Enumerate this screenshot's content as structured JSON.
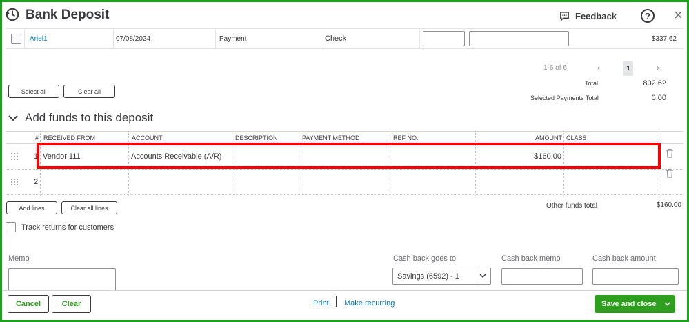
{
  "header": {
    "title": "Bank Deposit",
    "feedback_label": "Feedback",
    "help_label": "?",
    "close_label": "×"
  },
  "payment_row": {
    "name": "Ariel1",
    "date": "07/08/2024",
    "type": "Payment",
    "method": "Check",
    "amount": "$337.62"
  },
  "pager": {
    "range": "1-6 of 6",
    "prev": "‹",
    "page": "1",
    "next": "›"
  },
  "selection": {
    "select_all": "Select all",
    "clear_all": "Clear all"
  },
  "totals": {
    "total_label": "Total",
    "total_value": "802.62",
    "selected_label": "Selected Payments Total",
    "selected_value": "0.00"
  },
  "funds": {
    "section_title": "Add funds to this deposit",
    "columns": [
      "#",
      "RECEIVED FROM",
      "ACCOUNT",
      "DESCRIPTION",
      "PAYMENT METHOD",
      "REF NO.",
      "AMOUNT",
      "CLASS"
    ],
    "rows": [
      {
        "num": "1",
        "received_from": "Vendor 111",
        "account": "Accounts Receivable (A/R)",
        "description": "",
        "payment_method": "",
        "ref_no": "",
        "amount": "$160.00",
        "class": ""
      },
      {
        "num": "2",
        "received_from": "",
        "account": "",
        "description": "",
        "payment_method": "",
        "ref_no": "",
        "amount": "",
        "class": ""
      }
    ],
    "add_lines": "Add lines",
    "clear_all_lines": "Clear all lines",
    "other_total_label": "Other funds total",
    "other_total_value": "$160.00",
    "track_returns": "Track returns for customers"
  },
  "form": {
    "memo_label": "Memo",
    "cash_back_goes_to_label": "Cash back goes to",
    "cash_back_goes_to_value": "Savings (6592) - 1",
    "cash_back_memo_label": "Cash back memo",
    "cash_back_amount_label": "Cash back amount"
  },
  "footer": {
    "cancel": "Cancel",
    "clear": "Clear",
    "print": "Print",
    "make_recurring": "Make recurring",
    "save_and_close": "Save and close"
  },
  "colors": {
    "accent_green": "#2ca01c",
    "link_blue": "#0077c5",
    "highlight_red": "#ff0000",
    "frame_green": "#1aa31a"
  }
}
